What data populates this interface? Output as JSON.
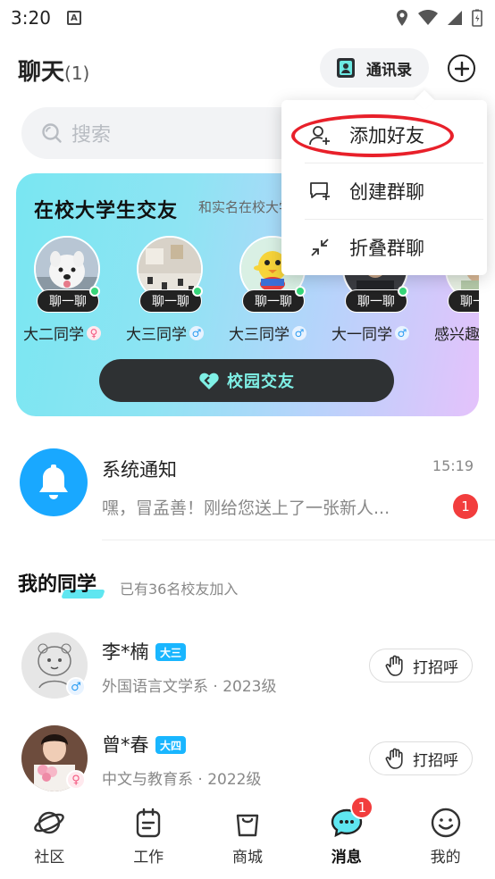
{
  "status_bar": {
    "time": "3:20",
    "a_icon_letter": "A"
  },
  "header": {
    "title": "聊天",
    "count": "(1)",
    "contacts_label": "通讯录"
  },
  "search": {
    "placeholder": "搜索"
  },
  "banner": {
    "title": "在校大学生交友",
    "subtitle": "和实名在校大学生",
    "button_label": "校园交友",
    "students": [
      {
        "chat_label": "聊一聊",
        "name": "大二同学",
        "gender": "female",
        "gender_symbol": "♀"
      },
      {
        "chat_label": "聊一聊",
        "name": "大三同学",
        "gender": "male",
        "gender_symbol": "♂"
      },
      {
        "chat_label": "聊一聊",
        "name": "大三同学",
        "gender": "male",
        "gender_symbol": "♂"
      },
      {
        "chat_label": "聊一聊",
        "name": "大一同学",
        "gender": "male",
        "gender_symbol": "♂"
      },
      {
        "chat_label": "聊一聊",
        "name": "感兴趣",
        "gender": "",
        "gender_symbol": ""
      }
    ]
  },
  "menu": {
    "items": [
      {
        "label": "添加好友",
        "icon": "add-person-icon"
      },
      {
        "label": "创建群聊",
        "icon": "create-group-icon"
      },
      {
        "label": "折叠群聊",
        "icon": "collapse-icon"
      }
    ],
    "highlight_color": "#e8202a"
  },
  "system_notice": {
    "name": "系统通知",
    "time": "15:19",
    "message": "嘿，冒孟善！刚给您送上了一张新人...",
    "unread": "1"
  },
  "classmates": {
    "title": "我的同学",
    "subtitle": "已有36名校友加入",
    "wave_label": "打招呼",
    "items": [
      {
        "name": "李*楠",
        "grade": "大三",
        "major": "外国语言文学系 · 2023级",
        "gender": "male",
        "gender_symbol": "♂"
      },
      {
        "name": "曾*春",
        "grade": "大四",
        "major": "中文与教育系 · 2022级",
        "gender": "female",
        "gender_symbol": "♀"
      }
    ]
  },
  "bottom_nav": {
    "items": [
      {
        "label": "社区",
        "icon": "planet-icon"
      },
      {
        "label": "工作",
        "icon": "clipboard-icon"
      },
      {
        "label": "商城",
        "icon": "shopping-bag-icon"
      },
      {
        "label": "消息",
        "icon": "chat-bubble-icon",
        "badge": "1",
        "active": true
      },
      {
        "label": "我的",
        "icon": "smile-icon"
      }
    ]
  },
  "colors": {
    "accent": "#19b6ff",
    "badge": "#f23d3d",
    "online": "#37d67a"
  }
}
